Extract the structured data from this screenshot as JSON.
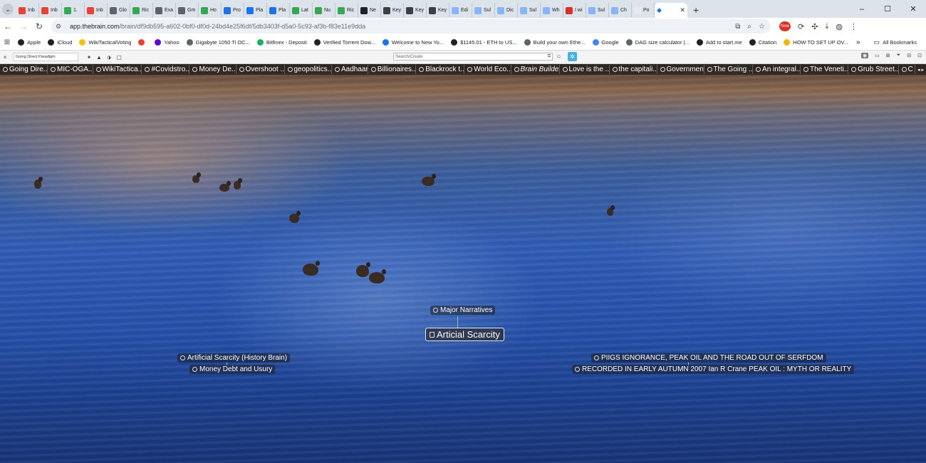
{
  "browser": {
    "tabs": [
      {
        "label": "Inb",
        "color": "#ea4335"
      },
      {
        "label": "Inb",
        "color": "#ea4335"
      },
      {
        "label": "1.",
        "color": "#34a853"
      },
      {
        "label": "Inb",
        "color": "#ea4335"
      },
      {
        "label": "Glo",
        "color": "#5f6368"
      },
      {
        "label": "Ric",
        "color": "#34a853"
      },
      {
        "label": "Exa",
        "color": "#5f6368"
      },
      {
        "label": "Gm",
        "color": "#5f6368"
      },
      {
        "label": "Ho",
        "color": "#34a853"
      },
      {
        "label": "Pro",
        "color": "#1a73e8"
      },
      {
        "label": "Pla",
        "color": "#1a73e8"
      },
      {
        "label": "Pla",
        "color": "#1a73e8"
      },
      {
        "label": "Lat",
        "color": "#34a853"
      },
      {
        "label": "Nu",
        "color": "#34a853"
      },
      {
        "label": "Ric",
        "color": "#34a853"
      },
      {
        "label": "Ne",
        "color": "#202124"
      },
      {
        "label": "Key",
        "color": "#3c4043"
      },
      {
        "label": "Key",
        "color": "#3c4043"
      },
      {
        "label": "Key",
        "color": "#3c4043"
      },
      {
        "label": "Edi",
        "color": "#8ab4f8"
      },
      {
        "label": "Sul",
        "color": "#8ab4f8"
      },
      {
        "label": "Dic",
        "color": "#8ab4f8"
      },
      {
        "label": "Sul",
        "color": "#8ab4f8"
      },
      {
        "label": "Wh",
        "color": "#8ab4f8"
      },
      {
        "label": "I wi",
        "color": "#d93025"
      },
      {
        "label": "Sul",
        "color": "#8ab4f8"
      },
      {
        "label": "Ch",
        "color": "#8ab4f8"
      },
      {
        "label": "Po",
        "color": "#e8eaed"
      }
    ],
    "active_tab": {
      "label": "",
      "icon": "brain-icon"
    },
    "new_tab_symbol": "+",
    "window_controls": [
      "–",
      "☐",
      "✕"
    ],
    "url_host": "app.thebrain.com",
    "url_path": "/brain/df9db595-a602-0bf0-df0d-24bd4e25f6df/5db3403f-d5a0-5c93-af3b-f83e11e9dda",
    "new_badge": "New"
  },
  "bookmarks": [
    {
      "label": "Apple",
      "color": "#202124"
    },
    {
      "label": "iCloud",
      "color": "#202124"
    },
    {
      "label": "WikiTacticalVoting",
      "color": "#f4c20d"
    },
    {
      "label": "",
      "color": "#ea4335"
    },
    {
      "label": "Yahoo",
      "color": "#6001d2"
    },
    {
      "label": "Gigabyte 1050 Ti OC...",
      "color": "#5f6368"
    },
    {
      "label": "Bitfinex - Deposit",
      "color": "#16b157"
    },
    {
      "label": "Verified Torrent Dow...",
      "color": "#202124"
    },
    {
      "label": "Welcome to New Yo...",
      "color": "#1a73e8"
    },
    {
      "label": "$1145.01 - ETH to US...",
      "color": "#202124"
    },
    {
      "label": "Build your own Ethe...",
      "color": "#5f6368"
    },
    {
      "label": "Google",
      "color": "#4285f4"
    },
    {
      "label": "DAG size calculator |...",
      "color": "#5f6368"
    },
    {
      "label": "Add to start.me",
      "color": "#202124"
    },
    {
      "label": "Citation",
      "color": "#202124"
    },
    {
      "label": "HOW TO SET UP OV...",
      "color": "#f4b400"
    }
  ],
  "bookmarks_more": "»",
  "all_bookmarks": "All Bookmarks",
  "brain_toolbar": {
    "brain_name": "Going Direct Paradigm",
    "search_placeholder": "Search/Create"
  },
  "pins": [
    {
      "label": "Going Dire..."
    },
    {
      "label": "MIC-OGA..."
    },
    {
      "label": "WikiTactica..."
    },
    {
      "label": "#Covidstro..."
    },
    {
      "label": "Money De..."
    },
    {
      "label": "Overshoot ..."
    },
    {
      "label": "geopolitics..."
    },
    {
      "label": "Aadhaar"
    },
    {
      "label": "Billionaires..."
    },
    {
      "label": "Blackrock t..."
    },
    {
      "label": "World Eco..."
    },
    {
      "label": "Brain Builder",
      "italic": true
    },
    {
      "label": "Love is the ..."
    },
    {
      "label": "the capitali..."
    },
    {
      "label": "Government"
    },
    {
      "label": "The Going ..."
    },
    {
      "label": "An integral..."
    },
    {
      "label": "The Veneti..."
    },
    {
      "label": "Grub Street..."
    },
    {
      "label": "C"
    }
  ],
  "thoughts": {
    "parent": "Major Narratives",
    "active": "Articial Scarcity",
    "left_1": "Artificial Scarcity (History Brain)",
    "left_2": "Money Debt and Usury",
    "right_1": "PIIGS IGNORANCE, PEAK OIL AND THE ROAD OUT OF SERFDOM",
    "right_2": "RECORDED IN EARLY AUTUMN 2007 Ian R Crane PEAK OIL : MYTH OR REALITY"
  }
}
